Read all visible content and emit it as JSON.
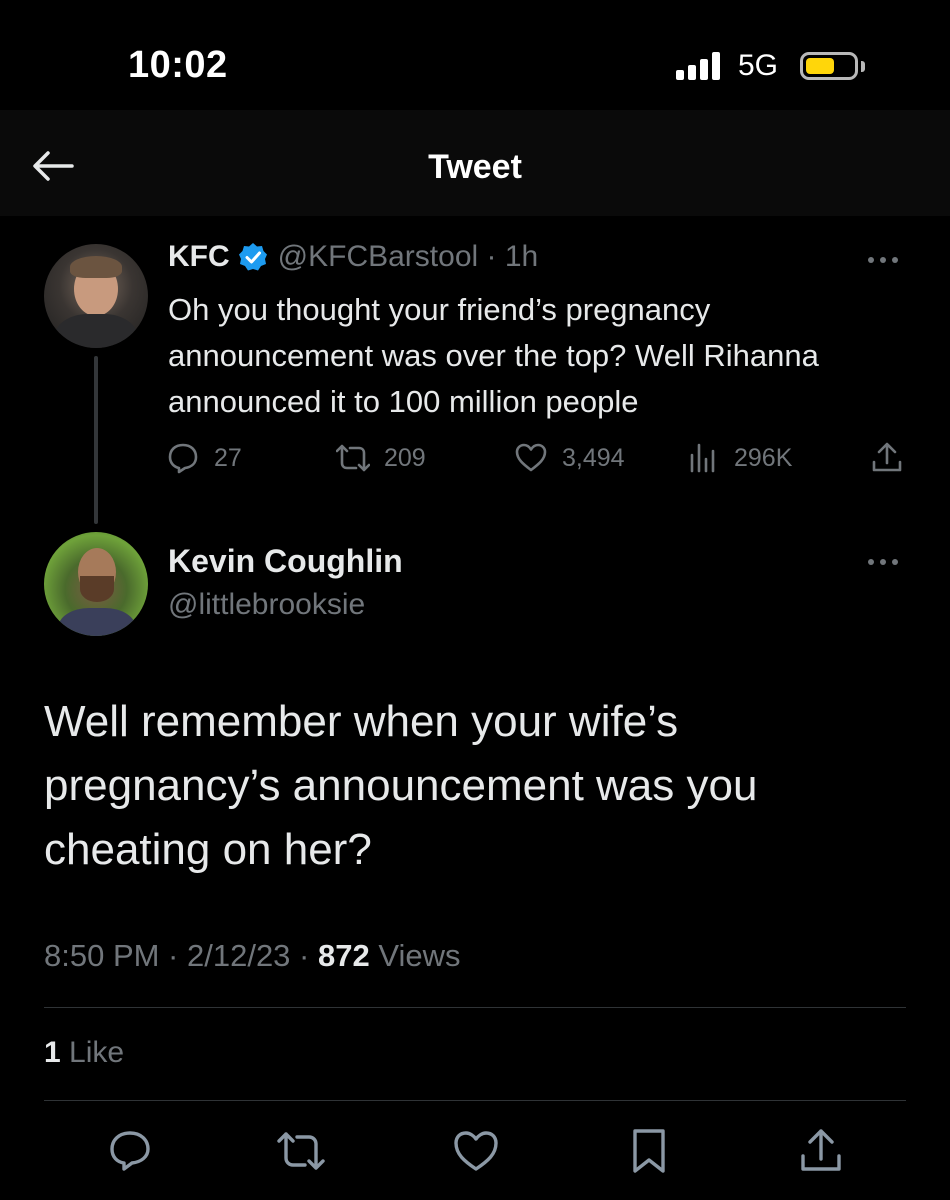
{
  "status_bar": {
    "time": "10:02",
    "network": "5G",
    "icons": [
      "signal-icon",
      "battery-icon"
    ]
  },
  "header": {
    "title": "Tweet",
    "back_icon": "back-arrow-icon"
  },
  "original_tweet": {
    "display_name": "KFC",
    "verified": true,
    "handle_time": "@KFCBarstool · 1h",
    "text": "Oh you thought your friend’s pregnancy announcement was over the top? Well Rihanna announced it to 100 million people",
    "stats": {
      "replies": "27",
      "retweets": "209",
      "likes": "3,494",
      "views": "296K"
    }
  },
  "reply": {
    "display_name": "Kevin Coughlin",
    "handle": "@littlebrooksie",
    "text": "Well remember when your wife’s pregnancy’s announcement was you cheating on her?",
    "time": "8:50 PM · 2/12/23 · ",
    "views_count": "872",
    "views_label": " Views",
    "likes_count": "1",
    "likes_label": " Like"
  },
  "bottom_bar": {
    "icons": [
      "reply-icon",
      "retweet-icon",
      "like-icon",
      "bookmark-icon",
      "share-icon"
    ]
  },
  "colors": {
    "background": "#000000",
    "text_primary": "#e7e9ea",
    "text_secondary": "#71767b",
    "verified_blue": "#1d9bf0",
    "battery_yellow": "#ffd60a"
  }
}
